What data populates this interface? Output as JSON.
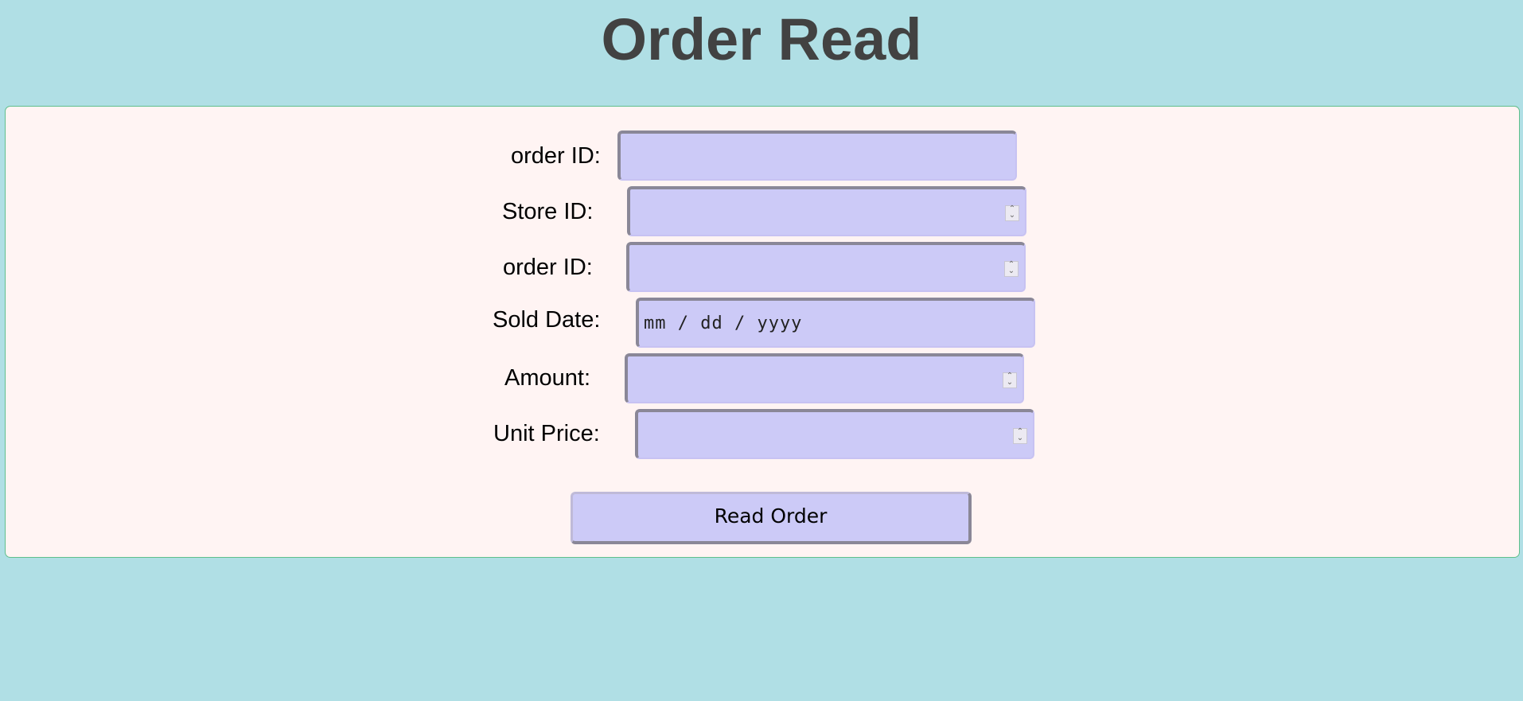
{
  "page": {
    "title": "Order Read"
  },
  "form": {
    "fields": [
      {
        "label": "order ID",
        "colon": ":",
        "value": "",
        "type": "text"
      },
      {
        "label": "Store ID",
        "colon": ":",
        "value": "",
        "type": "number"
      },
      {
        "label": "order ID",
        "colon": ":",
        "value": "",
        "type": "number"
      },
      {
        "label": "Sold Date",
        "colon": ":",
        "value": "",
        "placeholder": "mm / dd / yyyy",
        "type": "date"
      },
      {
        "label": "Amount",
        "colon": ":",
        "value": "",
        "type": "number"
      },
      {
        "label": "Unit Price",
        "colon": ":",
        "value": "",
        "type": "number"
      }
    ],
    "submit_label": "Read Order"
  },
  "colors": {
    "background": "#b0dfe5",
    "panel": "#fff4f3",
    "panel_border": "#5fbf8c",
    "input_fill": "#cccaf7",
    "title_text": "#424242"
  },
  "icons": {
    "spinner": "spinner-arrows-icon"
  }
}
